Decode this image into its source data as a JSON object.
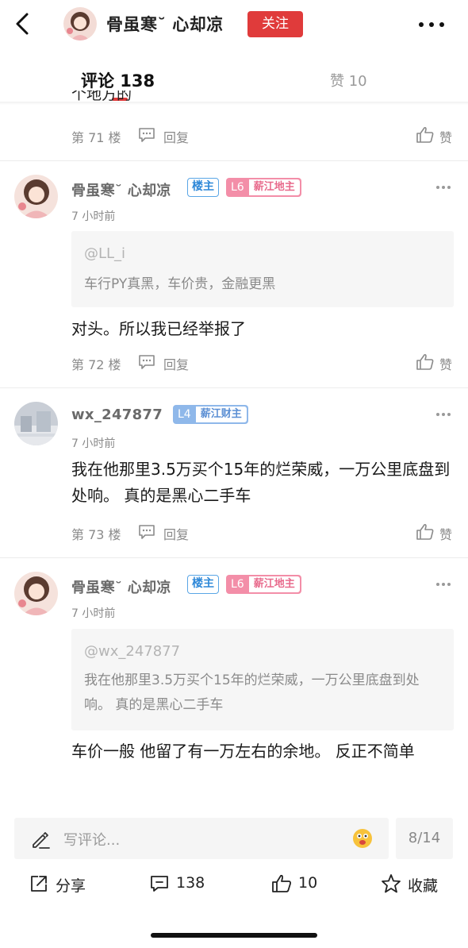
{
  "header": {
    "username": "骨虽寒˘ 心却凉",
    "follow_label": "关注"
  },
  "tabs": {
    "comments_label": "评论 138",
    "likes_label": "赞 10"
  },
  "partial_comment": {
    "text": "个地方的",
    "floor": "第 71 楼",
    "reply_label": "回复",
    "like_label": "赞"
  },
  "comments": [
    {
      "username": "骨虽寒˘ 心却凉",
      "host_badge": "楼主",
      "level": "L6",
      "level_title": "薪江地主",
      "time": "7 小时前",
      "quote_at": "@LL_i",
      "quote_text": "车行PY真黑，车价贵，金融更黑",
      "body": "对头。所以我已经举报了",
      "floor": "第 72 楼",
      "reply_label": "回复",
      "like_label": "赞"
    },
    {
      "username": "wx_247877",
      "level": "L4",
      "level_title": "薪江财主",
      "time": "7 小时前",
      "body": "我在他那里3.5万买个15年的烂荣威，一万公里底盘到处响。  真的是黑心二手车",
      "floor": "第 73 楼",
      "reply_label": "回复",
      "like_label": "赞"
    },
    {
      "username": "骨虽寒˘ 心却凉",
      "host_badge": "楼主",
      "level": "L6",
      "level_title": "薪江地主",
      "time": "7 小时前",
      "quote_at": "@wx_247877",
      "quote_text": "我在他那里3.5万买个15年的烂荣威，一万公里底盘到处响。  真的是黑心二手车",
      "body": "车价一般 他留了有一万左右的余地。 反正不简单"
    }
  ],
  "input": {
    "placeholder": "写评论...",
    "page_indicator": "8/14"
  },
  "actions": {
    "share": "分享",
    "comments": "138",
    "likes": "10",
    "favorite": "收藏"
  },
  "colors": {
    "accent_red": "#e03b3b",
    "host_badge_blue": "#2e88d8",
    "level_pink": "#f38ea8",
    "level_blue": "#8fb8ea"
  }
}
